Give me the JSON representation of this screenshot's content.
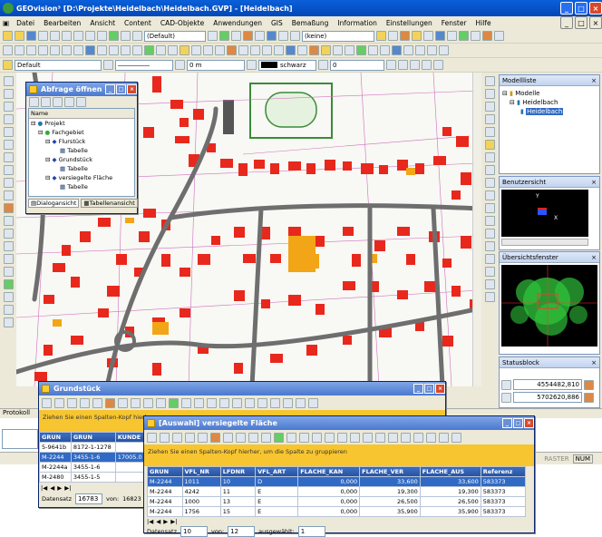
{
  "app_title": "GEOvision³  [D:\\Projekte\\Heidelbach\\Heidelbach.GVP] - [Heidelbach]",
  "menu": [
    "Datei",
    "Bearbeiten",
    "Ansicht",
    "Content",
    "CAD-Objekte",
    "Anwendungen",
    "GIS",
    "Bemaßung",
    "Information",
    "Einstellungen",
    "Fenster",
    "Hilfe"
  ],
  "toolbar1": {
    "combo1": "(Default)",
    "combo2": "(keine)"
  },
  "toolbar2": {
    "layer": "Default",
    "width": "0 m",
    "color": "schwarz",
    "angle": "0"
  },
  "abfrage": {
    "title": "Abfrage öffnen",
    "col_name": "Name",
    "tree": [
      {
        "label": "Projekt",
        "level": 0
      },
      {
        "label": "Fachgebiet",
        "level": 1
      },
      {
        "label": "Flurstück",
        "level": 2
      },
      {
        "label": "Tabelle",
        "level": 3
      },
      {
        "label": "Grundstück",
        "level": 2
      },
      {
        "label": "Tabelle",
        "level": 3
      },
      {
        "label": "versiegelte Fläche",
        "level": 2
      },
      {
        "label": "Tabelle",
        "level": 3
      }
    ],
    "tab1": "Dialogansicht",
    "tab2": "Tabellenansicht"
  },
  "modellliste": {
    "title": "Modellliste",
    "items": [
      "Modelle",
      "Heidelbach",
      "Heidelbach"
    ]
  },
  "benutzersicht": {
    "title": "Benutzersicht",
    "axis_y": "Y",
    "axis_x": "X"
  },
  "uebersicht": {
    "title": "Übersichtsfenster"
  },
  "statusblock": {
    "title": "Statusblock",
    "x": "4554482,810",
    "y": "5702620,886"
  },
  "protokoll": {
    "title": "Protokoll"
  },
  "statusbar": {
    "snap": "RASTER",
    "num": "NUM"
  },
  "grundstueck": {
    "title": "Grundstück",
    "group_hint": "Ziehen Sie einen Spalten-Kopf hierher",
    "headers": [
      "GRUN",
      "GRUN",
      "KUNDE"
    ],
    "rows": [
      [
        "5-9641b",
        "8172-1-1278",
        ""
      ],
      [
        "M-2244",
        "3455-1-6",
        "17005.0"
      ],
      [
        "M-2244a",
        "3455-1-6",
        ""
      ],
      [
        "M-2480",
        "3455-1-5",
        ""
      ]
    ],
    "footer_label": "Datensatz",
    "footer_value": "16783",
    "footer_of": "von:",
    "footer_total": "16823"
  },
  "auswahl": {
    "title": "[Auswahl] versiegelte Fläche",
    "group_hint": "Ziehen Sie einen Spalten-Kopf hierher, um die Spalte zu gruppieren",
    "headers": [
      "GRUN",
      "VFL_NR",
      "LFDNR",
      "VFL_ART",
      "FLACHE_KAN",
      "FLACHE_VER",
      "FLACHE_AUS",
      "Referenz"
    ],
    "rows": [
      [
        "M-2244",
        "1011",
        "10",
        "D",
        "0,000",
        "33,600",
        "33,600",
        "583373"
      ],
      [
        "M-2244",
        "4242",
        "11",
        "E",
        "0,000",
        "19,300",
        "19,300",
        "583373"
      ],
      [
        "M-2244",
        "1000",
        "13",
        "E",
        "0,000",
        "26,500",
        "26,500",
        "583373"
      ],
      [
        "M-2244",
        "1756",
        "15",
        "E",
        "0,000",
        "35,900",
        "35,900",
        "583373"
      ]
    ],
    "footer_label": "Datensatz",
    "footer_value": "10",
    "footer_of": "von:",
    "footer_total": "12",
    "footer_sel": "ausgewählt:",
    "footer_sel_val": "1"
  }
}
